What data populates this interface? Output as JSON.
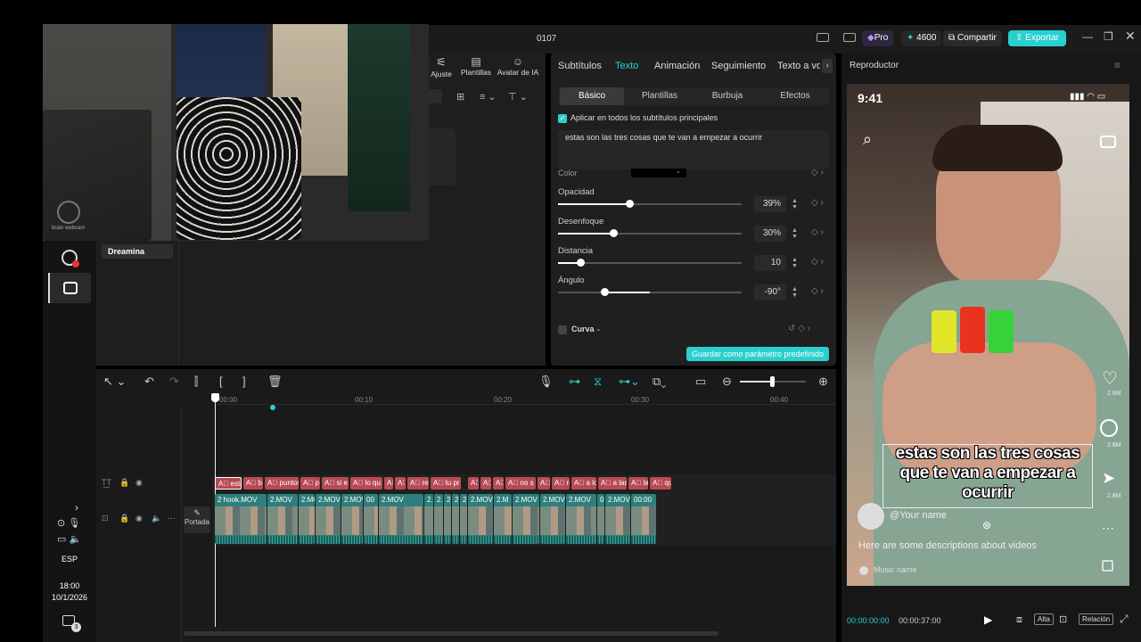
{
  "window": {
    "title": "0107",
    "pro_label": "Pro",
    "credits": "4600",
    "share_label": "Compartir",
    "export_label": "Exportar",
    "accent": "#2ad0cf"
  },
  "webcam": {
    "watermark": "brain webcam"
  },
  "media": {
    "tools": [
      {
        "label": "Ajuste"
      },
      {
        "label": "Plantillas"
      },
      {
        "label": "Avatar de IA"
      }
    ],
    "card_text": "IA",
    "sidebar_item": "Dreamina"
  },
  "system": {
    "lang": "ESP",
    "time": "18:00",
    "date": "10/1/2026",
    "notif_count": "3"
  },
  "props": {
    "tabs": [
      "Subtítulos",
      "Texto",
      "Animación",
      "Seguimiento",
      "Texto a vo"
    ],
    "active_tab": "Texto",
    "subtabs": [
      "Básico",
      "Plantillas",
      "Burbuja",
      "Efectos"
    ],
    "apply_all": "Aplicar en todos los subtítulos principales",
    "text_value": "estas son las tres cosas que te van a empezar a ocurrir",
    "color_label": "Color",
    "rows": [
      {
        "label": "Opacidad",
        "value": "39%",
        "level": 0.39
      },
      {
        "label": "Desenfoque",
        "value": "30%",
        "level": 0.3
      },
      {
        "label": "Distancia",
        "value": "10",
        "level": 0.1
      },
      {
        "label": "Ángulo",
        "value": "-90°",
        "level": 0.25
      }
    ],
    "curve_label": "Curva",
    "save_preset": "Guardar como parámetro predefinido"
  },
  "player": {
    "title": "Reproductor",
    "status_time": "9:41",
    "caption": "estas son las tres cosas que te van a empezar a ocurrir",
    "username": "@Your name",
    "description": "Here are some descriptions about videos",
    "music": "Music name",
    "counts": [
      "2.8M",
      "2.8M",
      "2.8M"
    ],
    "current_time": "00:00:00:00",
    "total_time": "00:00:37:00",
    "quality_label": "Alta",
    "ratio_label": "Relación"
  },
  "timeline": {
    "ruler": [
      "00:00",
      "00:10",
      "00:20",
      "00:30",
      "00:40"
    ],
    "cover_label": "Portada",
    "text_clips": [
      "esta",
      "b",
      "puntos",
      "p",
      "si e",
      "lo qu",
      "A",
      "A",
      "res",
      "tu pr",
      "A",
      "A",
      "A",
      "no s",
      "A",
      "re",
      "a los t",
      "a las t",
      "las",
      "qu"
    ],
    "video_clips": [
      "2 hook.MOV",
      "2.MOV",
      "2.MOV",
      "2.MOV",
      "2.MOV",
      "00",
      "2.MOV",
      "2.MOV",
      "2.M",
      "2",
      "2",
      "2",
      "2.MOV",
      "2.M",
      "2.MOV",
      "2.MOV",
      "2.MOV",
      "0",
      "2.MOV",
      "00:00"
    ]
  }
}
